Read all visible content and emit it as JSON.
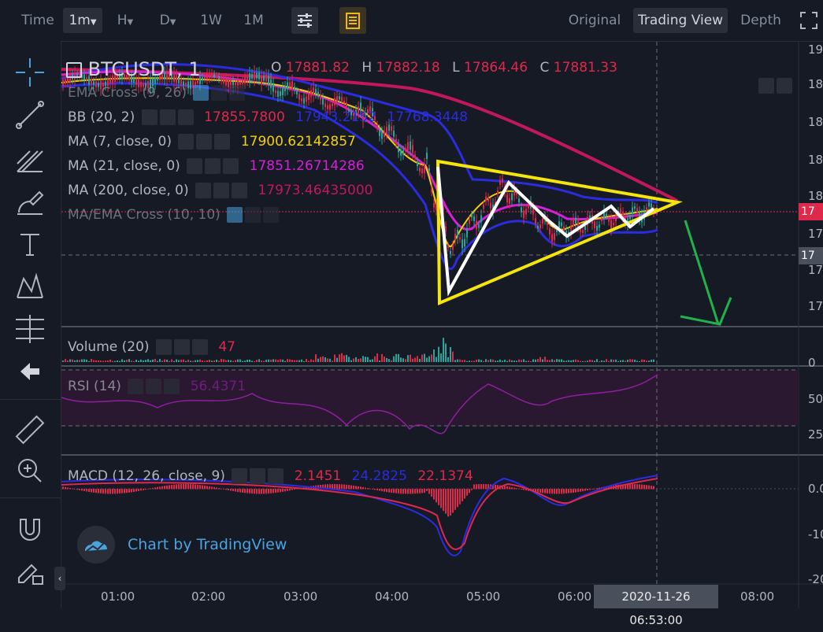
{
  "toolbar": {
    "time_label": "Time",
    "intervals": [
      "1m",
      "H",
      "D",
      "1W",
      "1M"
    ],
    "views": [
      "Original",
      "Trading View",
      "Depth"
    ],
    "active_view": "Trading View",
    "active_interval": "1m"
  },
  "legend": {
    "symbol": "BTCUSDT, 1",
    "ohlc": {
      "o_label": "O",
      "o": "17881.82",
      "h_label": "H",
      "h": "17882.18",
      "l_label": "L",
      "l": "17864.46",
      "c_label": "C",
      "c": "17881.33"
    },
    "indicators": [
      {
        "name": "EMA Cross (9, 26)",
        "values": [],
        "color": "#b2b5be"
      },
      {
        "name": "BB (20, 2)",
        "values": [
          "17855.7800",
          "17943.2152",
          "17768.3448"
        ],
        "colors": [
          "#e0294a",
          "#2c2cdf",
          "#2c2cdf"
        ]
      },
      {
        "name": "MA (7, close, 0)",
        "values": [
          "17900.62142857"
        ],
        "color": "#f5d100"
      },
      {
        "name": "MA (21, close, 0)",
        "values": [
          "17851.26714286"
        ],
        "color": "#d61fd6"
      },
      {
        "name": "MA (200, close, 0)",
        "values": [
          "17973.46435000"
        ],
        "color": "#c2185b"
      },
      {
        "name": "MA/EMA Cross (10, 10)",
        "values": [],
        "color": "#b2b5be"
      }
    ]
  },
  "panes": {
    "volume": {
      "name": "Volume (20)",
      "value": "47",
      "value_color": "#e0294a"
    },
    "rsi": {
      "name": "RSI (14)",
      "value": "56.4371",
      "value_color": "#8e1fa0"
    },
    "macd": {
      "name": "MACD (12, 26, close, 9)",
      "values": [
        "2.1451",
        "24.2825",
        "22.1374"
      ],
      "colors": [
        "#e0294a",
        "#2c2cdf",
        "#e0294a"
      ]
    }
  },
  "axes": {
    "price_ticks": [
      "19",
      "18",
      "18",
      "18",
      "18",
      "18",
      "17",
      "17",
      "17",
      "17"
    ],
    "volume_ticks": [
      "0"
    ],
    "rsi_ticks": [
      "50",
      "25"
    ],
    "macd_ticks": [
      "0.0",
      "-10",
      "-20"
    ],
    "time_ticks": [
      "01:00",
      "02:00",
      "03:00",
      "04:00",
      "05:00",
      "06:00",
      "08:00"
    ],
    "crosshair_time": "2020-11-26 06:53:00",
    "price_tags": [
      "17",
      "17"
    ]
  },
  "watermark": "Chart by TradingView",
  "colors": {
    "bg": "#161a25",
    "up": "#26a69a",
    "down": "#e0294a",
    "annot_yellow": "#f5e50a",
    "annot_white": "#ffffff",
    "annot_green": "#22b24c"
  }
}
